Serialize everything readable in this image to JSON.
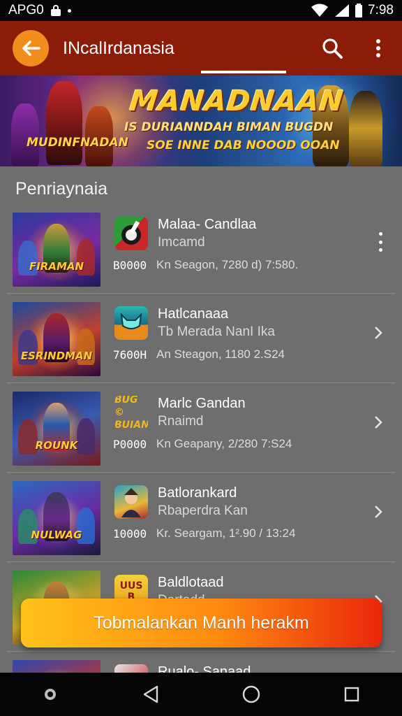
{
  "status_bar": {
    "carrier": "APG0",
    "time": "7:98",
    "icons": [
      "lock-icon",
      "notification-dot-icon",
      "wifi-icon",
      "signal-icon",
      "battery-icon"
    ]
  },
  "app_bar": {
    "title": "INcalIrdanasia",
    "back_icon": "arrow-left-icon",
    "search_icon": "search-icon",
    "more_icon": "more-vertical-icon",
    "accent_color": "#f28c1c",
    "bar_color": "#8a1c08"
  },
  "banner": {
    "left_label": "MUDINFNADAN",
    "title": "MANADNAAN",
    "line1": "IS DURIANNDAH BIMAN BUGDN",
    "line2": "SOE INNE DAB NOOOD OOAN"
  },
  "section": {
    "title": "Penriaynaia"
  },
  "games": [
    {
      "thumb_text": "FIRAMAN",
      "title": "Malaa- Candlaa",
      "subtitle": "Imcamd",
      "count": "B0000",
      "meta": "Kn Seagon, 7280 d) 7:580.",
      "action_icon": "more-vertical-icon"
    },
    {
      "thumb_text": "ESRINDMAN",
      "title": "Hatlcanaaa",
      "subtitle": "Tb Merada NanI Ika",
      "count": "7600H",
      "meta": "An Steagon, 1180 2.S24",
      "action_icon": "chevron-right-icon"
    },
    {
      "thumb_text": "ROUNK",
      "title": "Marlc Gandan",
      "subtitle": "Rnaimd",
      "count": "P0000",
      "meta": "Kn Geapany, 2/280 7:S24",
      "action_icon": "chevron-right-icon",
      "icon_text_top": "BUG ©",
      "icon_text_bottom": "BUIAN"
    },
    {
      "thumb_text": "NULWAG",
      "title": "Batlorankard",
      "subtitle": "Rbaperdra Kan",
      "count": "10000",
      "meta": "Kr. Seargam, 1².90 / 13:24",
      "action_icon": "chevron-right-icon"
    },
    {
      "thumb_text": "",
      "title": "Baldlotaad",
      "subtitle": "Dartadd",
      "count": "",
      "meta": "",
      "action_icon": "chevron-right-icon",
      "icon_text_top": "UUS",
      "icon_text_bottom": "B"
    },
    {
      "thumb_text": "",
      "title": "Rualo- Sanaad",
      "subtitle": "",
      "count": "",
      "meta": "",
      "action_icon": ""
    }
  ],
  "cta": {
    "label": "Tobmalankan Manh herakm"
  },
  "nav_bar": {
    "icons": [
      "assistant-icon",
      "back-triangle-icon",
      "home-circle-icon",
      "recents-square-icon"
    ]
  }
}
